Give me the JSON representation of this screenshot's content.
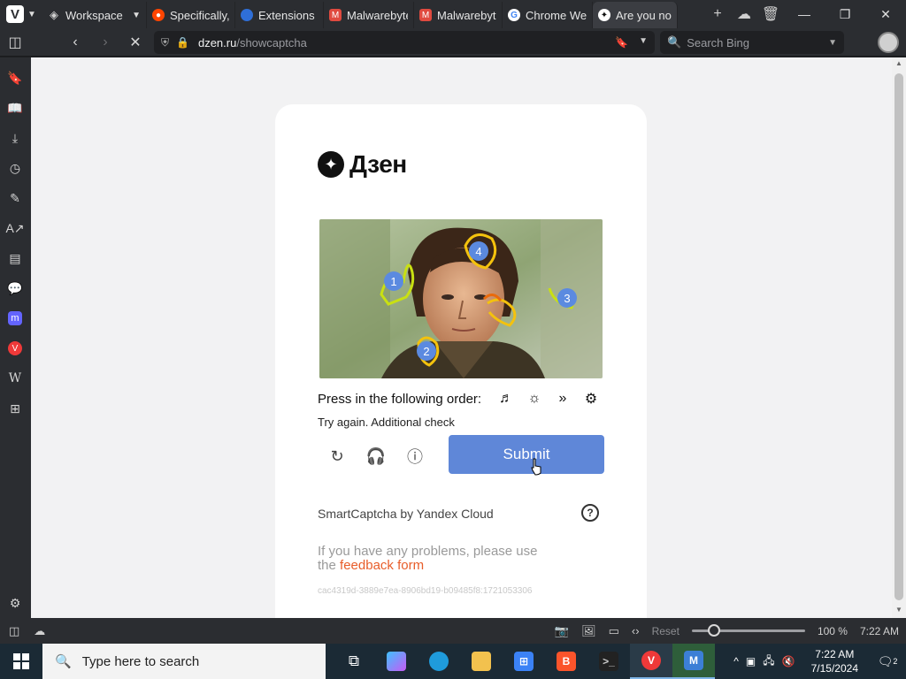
{
  "browser": {
    "tabs": [
      {
        "label": "Workspaces",
        "icon": "workspaces-icon",
        "color": "#cfcfcf"
      },
      {
        "label": "Specifically, v",
        "icon": "reddit-icon",
        "color": "#ff4500"
      },
      {
        "label": "Extensions",
        "icon": "extensions-icon",
        "color": "#2f6fd8"
      },
      {
        "label": "Malwarebyte",
        "icon": "malwarebytes-icon",
        "color": "#e04a3f"
      },
      {
        "label": "Malwarebyte",
        "icon": "malwarebytes-icon",
        "color": "#e04a3f"
      },
      {
        "label": "Chrome Web",
        "icon": "google-icon",
        "color": "#ffffff"
      },
      {
        "label": "Are you not a",
        "icon": "dzen-icon",
        "color": "#111111"
      }
    ],
    "url": {
      "host": "dzen.ru",
      "path": "/showcaptcha"
    },
    "search_placeholder": "Search Bing"
  },
  "captcha": {
    "brand": "Дзен",
    "image_markers": [
      "1",
      "2",
      "3",
      "4"
    ],
    "instruction": "Press in the following order:",
    "order_hint_icons": [
      "note-glyph-icon",
      "sun-glyph-icon",
      "arrows-glyph-icon",
      "gear-glyph-icon"
    ],
    "status": "Try again. Additional check",
    "submit_label": "Submit",
    "credit": "SmartCaptcha by Yandex Cloud",
    "problem_text_before": "If you have any problems, please use",
    "problem_text_the": "the",
    "feedback_link": "feedback form",
    "request_id": "cac4319d-3889e7ea-8906bd19-b09485f8:1721053306",
    "accent_color": "#5f87d8",
    "link_color": "#e85d2a"
  },
  "statusbar": {
    "reset_label": "Reset",
    "zoom_level": "100 %",
    "zoom_fraction": 0.14,
    "time": "7:22 AM"
  },
  "taskbar": {
    "search_placeholder": "Type here to search",
    "clock_time": "7:22 AM",
    "clock_date": "7/15/2024",
    "notification_count": "2"
  }
}
